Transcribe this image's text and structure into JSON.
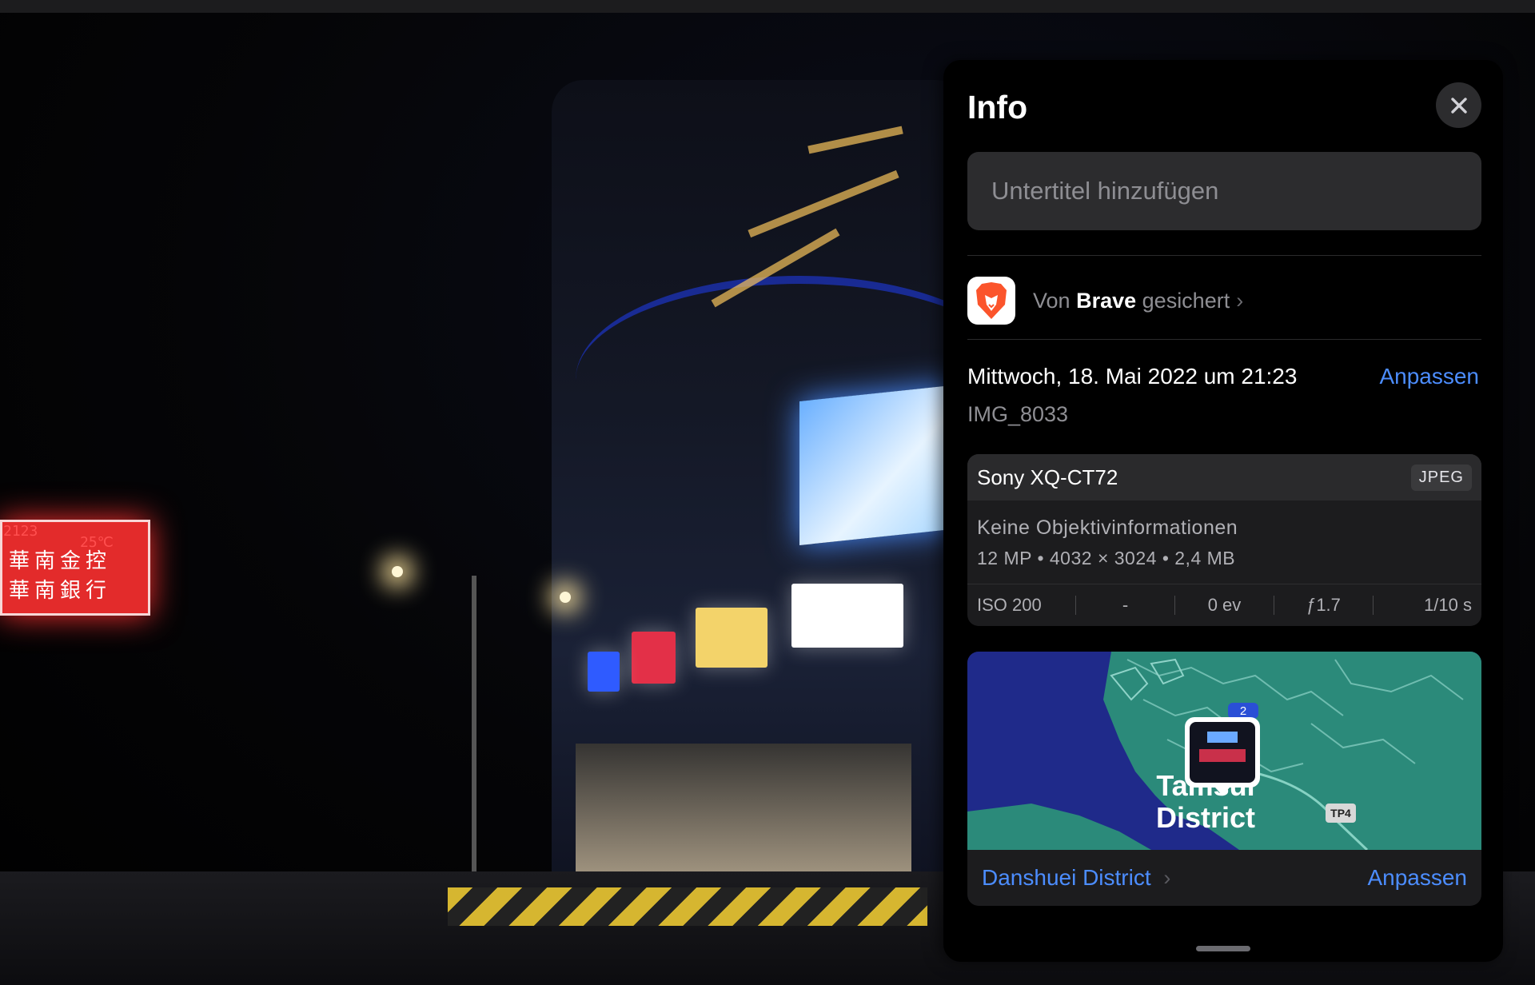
{
  "photo": {
    "bank_sign_line1": "華南金控",
    "bank_sign_line2": "華南銀行",
    "bank_sign_time": "2123",
    "bank_sign_temp": "25℃"
  },
  "panel": {
    "title": "Info",
    "close_icon": "xmark-icon",
    "caption_placeholder": "Untertitel hinzufügen",
    "saved": {
      "prefix": "Von",
      "app": "Brave",
      "suffix": "gesichert"
    },
    "date": "Mittwoch, 18. Mai 2022 um 21:23",
    "date_adjust": "Anpassen",
    "filename": "IMG_8033",
    "camera": {
      "model": "Sony XQ-CT72",
      "format": "JPEG",
      "lens": "Keine Objektivinformationen",
      "specs": "12 MP • 4032 × 3024 • 2,4 MB",
      "exif": [
        "ISO 200",
        "-",
        "0 ev",
        "ƒ1.7",
        "1/10 s"
      ]
    },
    "map": {
      "district_label_1": "Tamsui",
      "district_label_2": "District",
      "road_badge_1": "2",
      "road_badge_2": "TP4",
      "place": "Danshuei District",
      "adjust": "Anpassen"
    }
  }
}
